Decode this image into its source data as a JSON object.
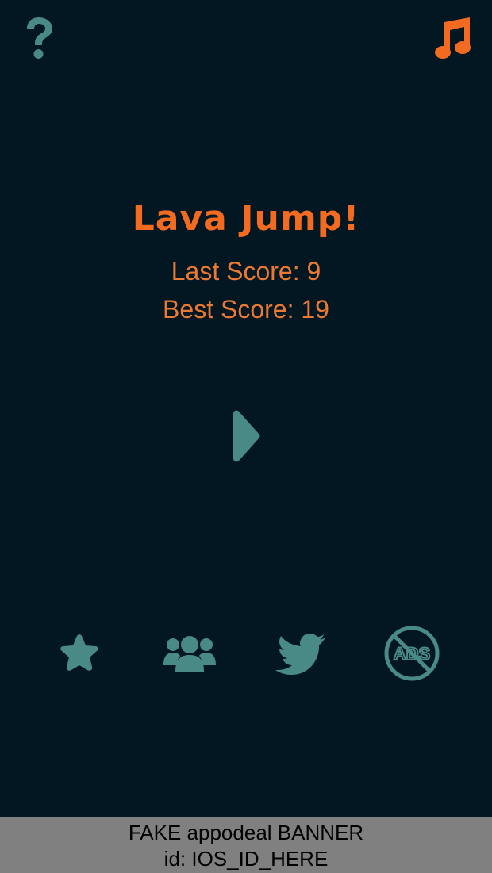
{
  "top_bar": {
    "help_icon": "question-mark-icon",
    "music_icon": "music-note-icon"
  },
  "menu": {
    "title": "Lava Jump!",
    "last_score": "Last Score: 9",
    "best_score": "Best Score: 19",
    "play_icon": "play-icon"
  },
  "bottom_buttons": [
    {
      "name": "rate",
      "icon": "star-icon"
    },
    {
      "name": "friends",
      "icon": "group-icon"
    },
    {
      "name": "twitter",
      "icon": "twitter-bird-icon"
    },
    {
      "name": "no-ads",
      "icon": "no-ads-icon",
      "label": "ADS"
    }
  ],
  "banner": {
    "line1": "FAKE appodeal BANNER",
    "line2": "id: IOS_ID_HERE"
  },
  "colors": {
    "background": "#021722",
    "accent_orange": "#f36b21",
    "score_orange": "#ea7a33",
    "icon_teal": "#4a8a86",
    "banner_gray": "#808080"
  }
}
